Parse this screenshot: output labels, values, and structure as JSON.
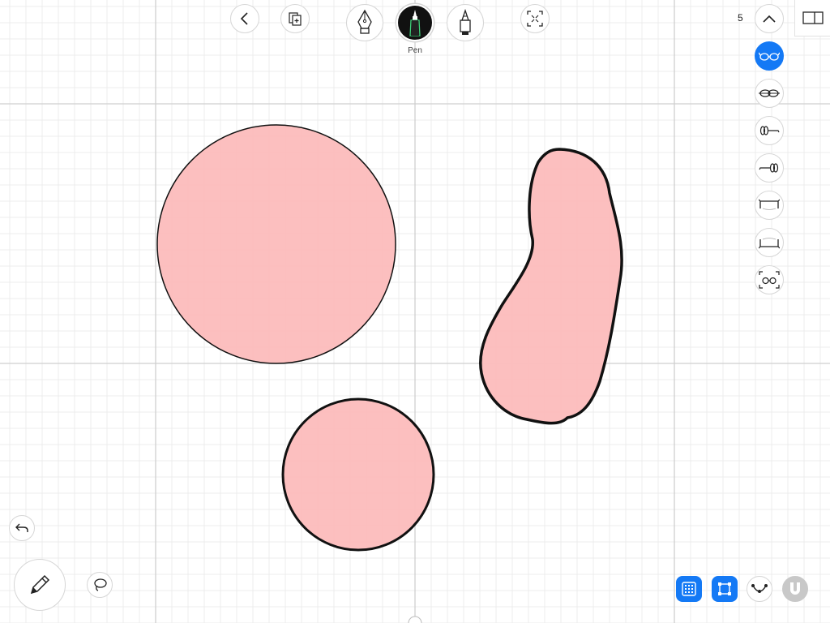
{
  "toolbar": {
    "selected_tool_label": "Pen",
    "back_icon": "chevron-left-icon",
    "pages_icon": "pages-add-icon",
    "transform_icon": "transform-frame-icon",
    "tools": [
      "fountain-pen-icon",
      "pen-icon",
      "marker-icon"
    ]
  },
  "right_panel": {
    "count_label": "5",
    "collapse_icon": "chevron-up-icon",
    "view_icon": "split-view-icon",
    "options": [
      {
        "icon": "glasses-oval-icon",
        "active": true
      },
      {
        "icon": "glasses-side-icon",
        "active": false
      },
      {
        "icon": "glasses-arm-left-icon",
        "active": false
      },
      {
        "icon": "glasses-arm-right-icon",
        "active": false
      },
      {
        "icon": "glasses-top-frame-icon",
        "active": false
      },
      {
        "icon": "glasses-bottom-frame-icon",
        "active": false
      },
      {
        "icon": "glasses-frame-fit-icon",
        "active": false
      }
    ]
  },
  "bottom_right": [
    "grid-icon",
    "snap-frame-icon",
    "curve-icon",
    "magnet-icon"
  ],
  "bottom_left": [
    "undo-icon",
    "pencil-icon",
    "lasso-icon"
  ],
  "colors": {
    "shape_fill": "#fcbcbc",
    "shape_stroke": "#111111",
    "accent": "#1479f5",
    "grid_minor": "#ececec",
    "grid_major": "#cfcfcf"
  }
}
